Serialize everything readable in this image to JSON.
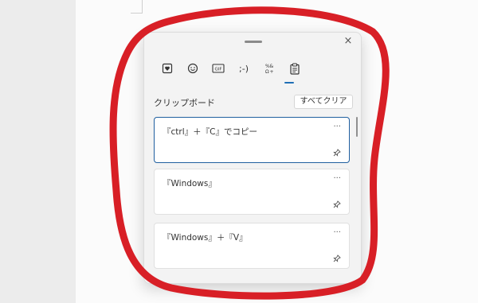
{
  "window": {
    "close_glyph": "×"
  },
  "tabs": [
    {
      "name": "stickers",
      "icon": "heart-card-icon",
      "selected": false
    },
    {
      "name": "emoji",
      "icon": "smiley-icon",
      "selected": false
    },
    {
      "name": "gif",
      "icon": "gif-icon",
      "label": "GIF",
      "selected": false
    },
    {
      "name": "kaomoji",
      "icon": "kaomoji-icon",
      "label": ";-)",
      "selected": false
    },
    {
      "name": "symbols",
      "icon": "symbols-icon",
      "label": "Ω",
      "selected": false
    },
    {
      "name": "clipboard",
      "icon": "clipboard-icon",
      "selected": true
    }
  ],
  "clipboard": {
    "title": "クリップボード",
    "clear_all_label": "すべてクリア",
    "items": [
      {
        "text": "『ctrl』＋『C』でコピー",
        "more": "···",
        "active": true
      },
      {
        "text": "『Windows』",
        "more": "···",
        "active": false
      },
      {
        "text": "『Windows』＋『V』",
        "more": "···",
        "active": false
      }
    ]
  },
  "colors": {
    "annotation": "#d81f26",
    "accent": "#1f6fb5"
  }
}
